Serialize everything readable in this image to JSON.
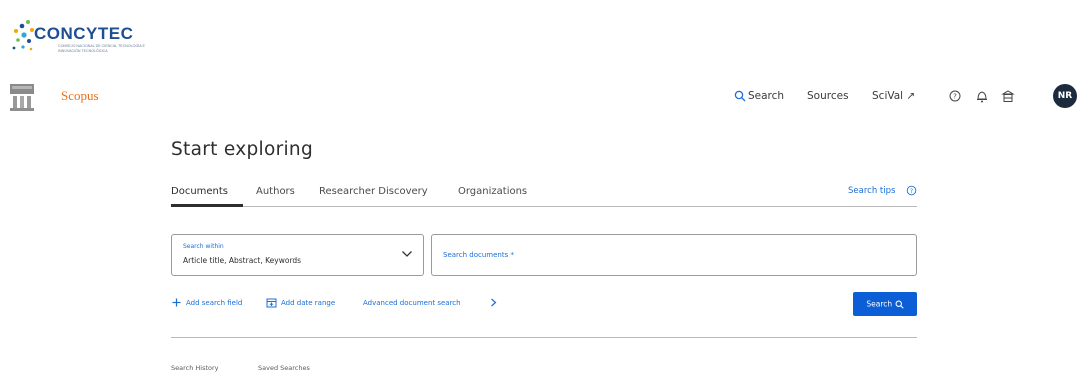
{
  "institution": {
    "name": "CONCYTEC",
    "subtitle": "CONSEJO NACIONAL DE CIENCIA, TECNOLOGÍA E INNOVACIÓN TECNOLÓGICA",
    "colors": {
      "dots": [
        "#f2a900",
        "#1d4f91",
        "#31a7d9",
        "#6cc04a"
      ],
      "text": "#1d4f91"
    }
  },
  "header": {
    "brand": "Scopus",
    "nav": {
      "search": "Search",
      "sources": "Sources",
      "scival": "SciVal ↗"
    },
    "icons": [
      "help-icon",
      "bell-icon",
      "library-icon"
    ],
    "avatar_initials": "NR"
  },
  "main": {
    "title": "Start exploring",
    "tabs": [
      {
        "label": "Documents",
        "active": true
      },
      {
        "label": "Authors",
        "active": false
      },
      {
        "label": "Researcher Discovery",
        "active": false
      },
      {
        "label": "Organizations",
        "active": false
      }
    ],
    "search_tips": "Search tips",
    "search_within": {
      "label": "Search within",
      "value": "Article title, Abstract, Keywords"
    },
    "search_documents": {
      "placeholder": "Search documents *"
    },
    "actions": {
      "add_field": "Add search field",
      "add_date": "Add date range",
      "advanced": "Advanced document search"
    },
    "search_button": "Search",
    "history_tabs": [
      "Search History",
      "Saved Searches"
    ]
  },
  "colors": {
    "accent": "#0c5ed6",
    "link": "#1a6ed8",
    "brand": "#e9711c"
  }
}
